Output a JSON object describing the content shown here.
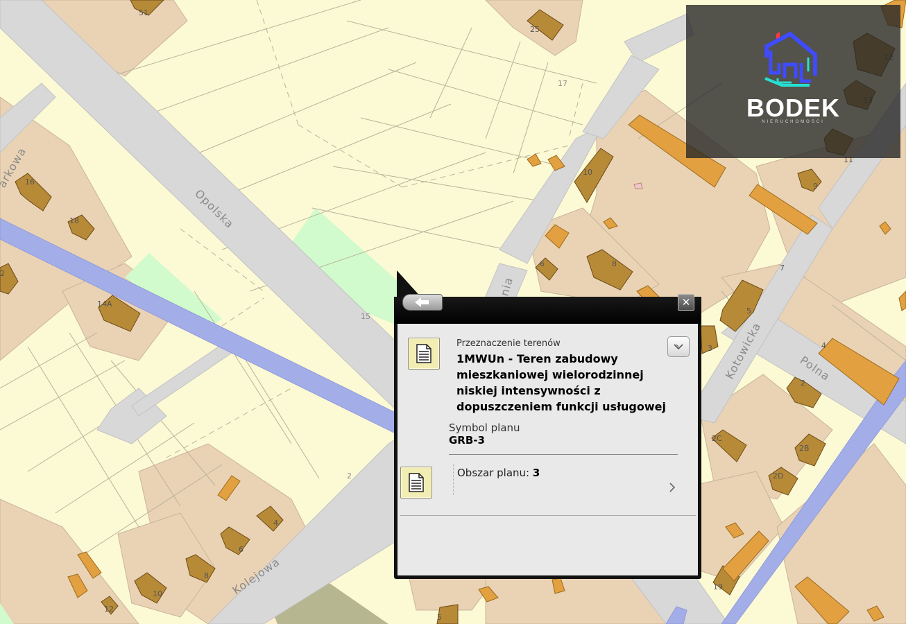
{
  "map": {
    "streets": [
      "Opolska",
      "Kolejowa",
      "Kotowicka",
      "Polna",
      "arkowa",
      "nia"
    ],
    "house_numbers": [
      "51",
      "25",
      "17",
      "16",
      "18",
      "10",
      "8",
      "6",
      "7",
      "9",
      "5",
      "3",
      "4",
      "2",
      "2C",
      "2B",
      "2D",
      "19",
      "14A",
      "15",
      "2",
      "4",
      "6",
      "8",
      "10",
      "12",
      "5",
      "12",
      "13",
      "11",
      "2"
    ]
  },
  "logo": {
    "name": "BODEK",
    "subtitle": "NIERUCHOMOŚCI",
    "colors": {
      "blue": "#3f4bff",
      "cyan": "#26e0d4",
      "red": "#ff3a3a"
    }
  },
  "popup": {
    "back_icon": "arrow-left-icon",
    "close_icon": "close-icon",
    "destination_label": "Przeznaczenie terenów",
    "destination_value": "1MWUn - Teren zabudowy mieszkaniowej wielorodzinnej niskiej intensywności z dopuszczeniem funkcji usługowej",
    "symbol_label": "Symbol planu",
    "symbol_value": "GRB-3",
    "area_label": "Obszar planu: ",
    "area_value": "3",
    "document_icon": "document-icon",
    "expand_icon": "chevron-down-icon",
    "next_icon": "chevron-right-icon"
  }
}
